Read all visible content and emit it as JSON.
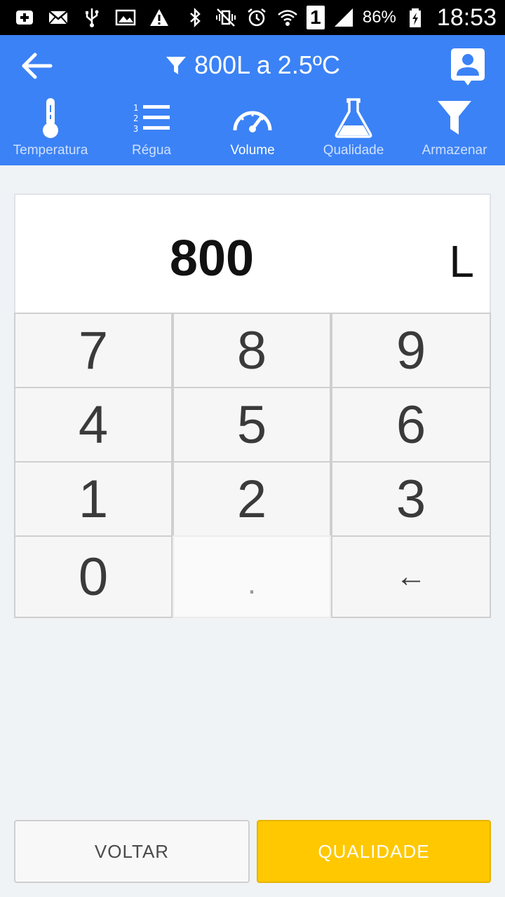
{
  "status_bar": {
    "battery": "86%",
    "time": "18:53",
    "sim": "1"
  },
  "header": {
    "title": "800L a 2.5ºC"
  },
  "tabs": [
    {
      "label": "Temperatura",
      "icon": "thermometer-icon"
    },
    {
      "label": "Régua",
      "icon": "numbered-list-icon"
    },
    {
      "label": "Volume",
      "icon": "gauge-icon",
      "active": true
    },
    {
      "label": "Qualidade",
      "icon": "flask-icon"
    },
    {
      "label": "Armazenar",
      "icon": "funnel-icon"
    }
  ],
  "display": {
    "value": "800",
    "unit": "L"
  },
  "keypad": {
    "k7": "7",
    "k8": "8",
    "k9": "9",
    "k4": "4",
    "k5": "5",
    "k6": "6",
    "k1": "1",
    "k2": "2",
    "k3": "3",
    "k0": "0",
    "kdot": ".",
    "kback": "←"
  },
  "footer": {
    "back_label": "VOLTAR",
    "next_label": "QUALIDADE"
  },
  "colors": {
    "appbar": "#3b82f6",
    "accent_button": "#ffc800"
  }
}
